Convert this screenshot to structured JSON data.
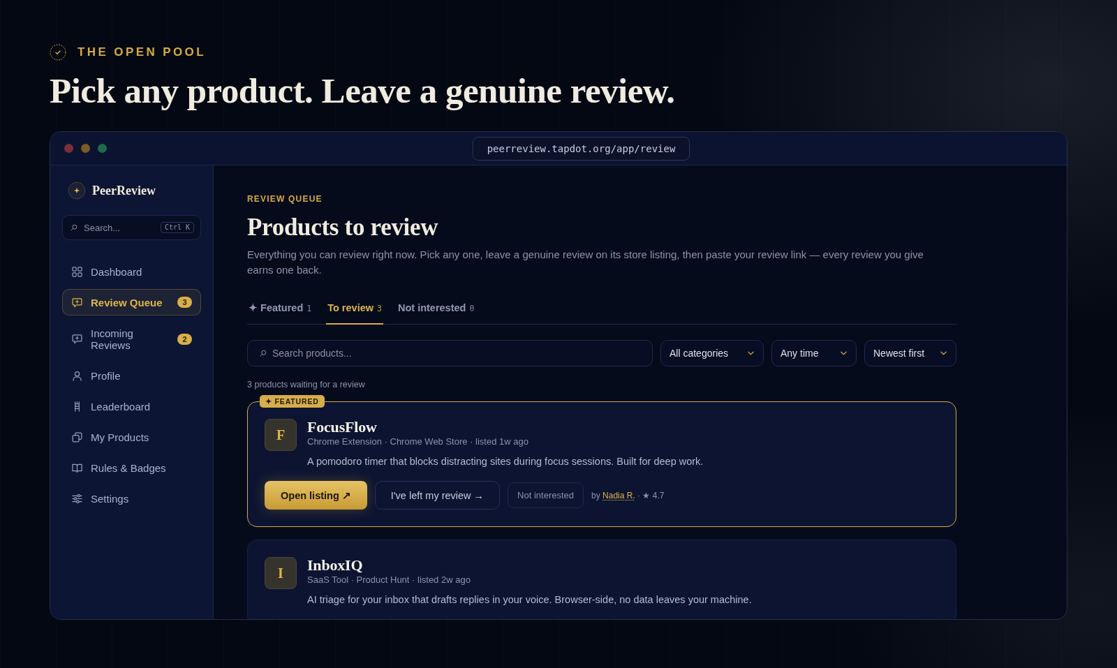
{
  "hero": {
    "eyebrow": "THE OPEN POOL",
    "title": "Pick any product. Leave a genuine review."
  },
  "browser": {
    "url": "peerreview.tapdot.org/app/review"
  },
  "sidebar": {
    "brand": "PeerReview",
    "search": {
      "placeholder": "Search...",
      "shortcut": "Ctrl K"
    },
    "items": [
      {
        "label": "Dashboard",
        "selected": false
      },
      {
        "label": "Review Queue",
        "selected": true,
        "badge": "3"
      },
      {
        "label": "Incoming Reviews",
        "selected": false,
        "badge": "2"
      },
      {
        "label": "Profile",
        "selected": false
      },
      {
        "label": "Leaderboard",
        "selected": false
      },
      {
        "label": "My Products",
        "selected": false
      },
      {
        "label": "Rules & Badges",
        "selected": false
      },
      {
        "label": "Settings",
        "selected": false
      }
    ]
  },
  "main": {
    "eyebrow": "REVIEW QUEUE",
    "title": "Products to review",
    "description": "Everything you can review right now. Pick any one, leave a genuine review on its store listing, then paste your review link — every review you give earns one back.",
    "tabs": [
      {
        "label": "✦ Featured",
        "count": "1",
        "selected": false
      },
      {
        "label": "To review",
        "count": "3",
        "selected": true
      },
      {
        "label": "Not interested",
        "count": "0",
        "selected": false
      }
    ],
    "filters": {
      "search": {
        "placeholder": "Search products..."
      },
      "dropdowns": [
        "All categories",
        "Any time",
        "Newest first"
      ]
    },
    "result_count": "3 products waiting for a review",
    "products": [
      {
        "featured": true,
        "badge": "✦ FEATURED",
        "initial": "F",
        "name": "FocusFlow",
        "meta": "Chrome Extension · Chrome Web Store · listed 1w ago",
        "description": "A pomodoro timer that blocks distracting sites during focus sessions. Built for deep work.",
        "actions": {
          "open": "Open listing ↗",
          "reviewed": "I've left my review →",
          "dismiss": "Not interested"
        },
        "byline": {
          "prefix": "by",
          "author": "Nadia R.",
          "rating": "· ★ 4.7"
        }
      },
      {
        "featured": false,
        "initial": "I",
        "name": "InboxIQ",
        "meta": "SaaS Tool · Product Hunt · listed 2w ago",
        "description": "AI triage for your inbox that drafts replies in your voice. Browser-side, no data leaves your machine."
      }
    ]
  }
}
